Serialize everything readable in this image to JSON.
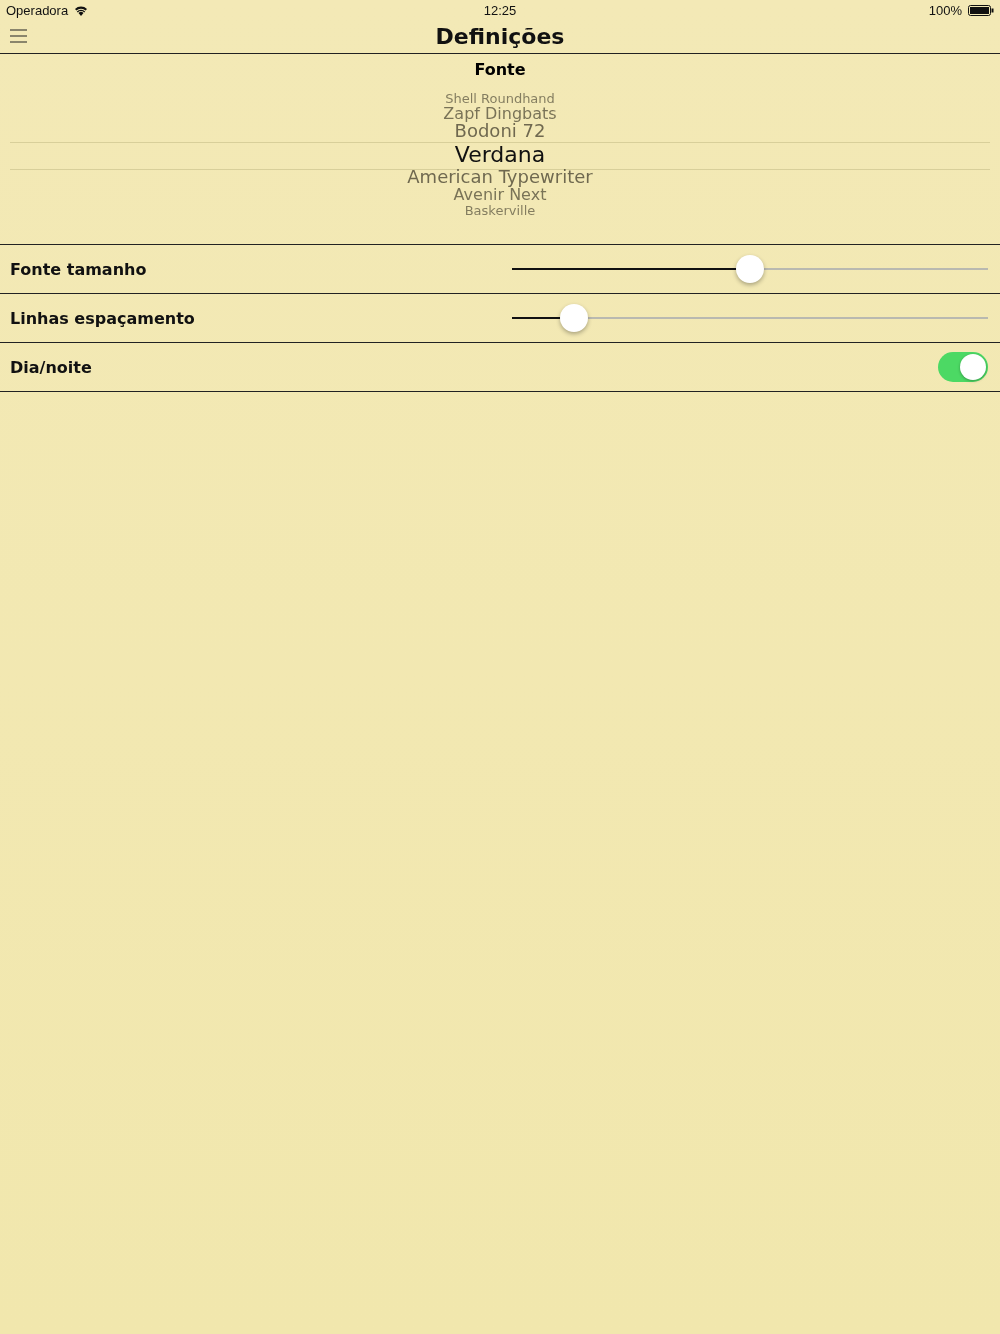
{
  "status_bar": {
    "carrier": "Operadora",
    "time": "12:25",
    "battery": "100%"
  },
  "nav": {
    "title": "Definições"
  },
  "font_picker": {
    "heading": "Fonte",
    "items": [
      {
        "label": "Shell Roundhand",
        "selected": false
      },
      {
        "label": "Zapf Dingbats",
        "selected": false
      },
      {
        "label": "Bodoni 72",
        "selected": false
      },
      {
        "label": "Verdana",
        "selected": true
      },
      {
        "label": "American Typewriter",
        "selected": false
      },
      {
        "label": "Avenir Next",
        "selected": false
      },
      {
        "label": "Baskerville",
        "selected": false
      }
    ]
  },
  "settings": [
    {
      "kind": "slider",
      "label": "Fonte tamanho",
      "level": 0.5
    },
    {
      "kind": "slider",
      "label": "Linhas espaçamento",
      "level": 0.13
    },
    {
      "kind": "toggle",
      "label": "Dia/noite",
      "on": true
    }
  ]
}
